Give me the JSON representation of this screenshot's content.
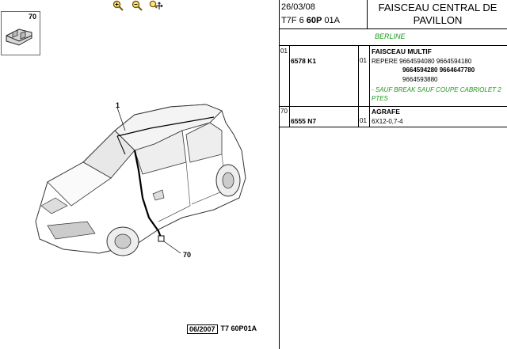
{
  "toolbar": {
    "icons": [
      "zoom-in-icon",
      "zoom-out-icon",
      "zoom-move-icon"
    ]
  },
  "diagram": {
    "thumbnail_label": "70",
    "callout_1": "1",
    "callout_70": "70",
    "footer_date": "06/2007",
    "footer_ref": "T7 60P01A"
  },
  "header": {
    "date": "26/03/08",
    "ref_prefix": "T7F 6 ",
    "ref_bold": "60P",
    "ref_suffix": " 01A",
    "title_line1": "FAISCEAU CENTRAL DE",
    "title_line2": "PAVILLON",
    "variant": "BERLINE"
  },
  "parts": [
    {
      "index": "01",
      "part_number": "6578 K1",
      "qty": "01",
      "title": "FAISCEAU MULTIF",
      "lines": [
        "REPERE 9664594080 9664594180",
        "9664594280 9664647780",
        "9664593880"
      ],
      "note_lines": [
        "- SAUF BREAK SAUF COUPE CABRIOLET 2",
        "PTES"
      ]
    },
    {
      "index": "70",
      "part_number": "6555 N7",
      "qty": "01",
      "title": "AGRAFE",
      "lines": [
        "6X12-0,7-4"
      ]
    }
  ]
}
